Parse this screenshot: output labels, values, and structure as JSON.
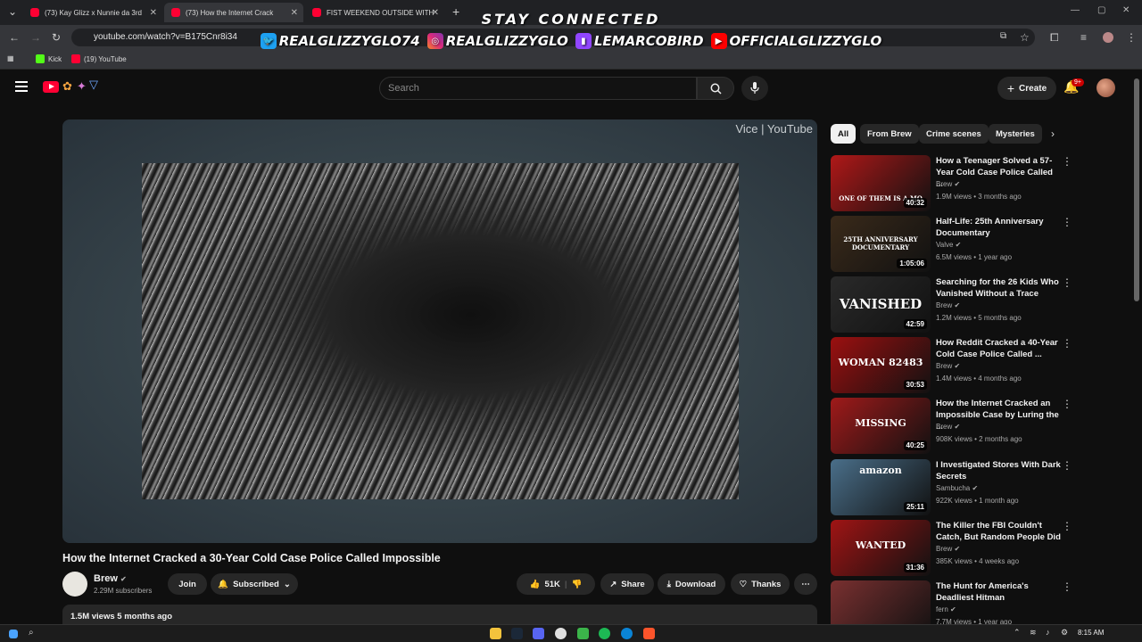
{
  "browser": {
    "tabs": [
      {
        "label": "(73) Kay Glizz x Nunnie da 3rd"
      },
      {
        "label": "(73) How the Internet Crack"
      },
      {
        "label": "FIST WEEKEND OUTSIDE WITH"
      }
    ],
    "url": "youtube.com/watch?v=B175Cnr8i34",
    "bookmarks": [
      {
        "label": "Kick"
      },
      {
        "label": "(19) YouTube"
      }
    ]
  },
  "overlay": {
    "headline": "STAY CONNECTED",
    "socials": [
      {
        "handle": "REALGLIZZYGLO74",
        "icon": "twitter-icon",
        "color": "#1da1f2"
      },
      {
        "handle": "REALGLIZZYGLO",
        "icon": "instagram-icon",
        "color": "#e1306c"
      },
      {
        "handle": "LEMARCOBIRD",
        "icon": "twitch-icon",
        "color": "#9146ff"
      },
      {
        "handle": "OFFICIALGLIZZYGLO",
        "icon": "youtube-icon",
        "color": "#ff0000"
      }
    ]
  },
  "youtube": {
    "search_placeholder": "Search",
    "create_label": "Create",
    "notifications_badge": "9+",
    "accent": "#ff0033"
  },
  "video": {
    "watermark": "Vice | YouTube",
    "title": "How the Internet Cracked a 30-Year Cold Case Police Called Impossible",
    "channel": "Brew",
    "subscribers": "2.29M subscribers",
    "join_label": "Join",
    "subscribed_label": "Subscribed",
    "likes": "51K",
    "share_label": "Share",
    "download_label": "Download",
    "thanks_label": "Thanks",
    "views_date": "1.5M views  5 months ago"
  },
  "chips": [
    {
      "label": "All"
    },
    {
      "label": "From Brew"
    },
    {
      "label": "Crime scenes"
    },
    {
      "label": "Mysteries"
    }
  ],
  "recommendations": [
    {
      "title": "How a Teenager Solved a 57-Year Cold Case Police Called ...",
      "channel": "Brew",
      "meta": "1.9M views • 3 months ago",
      "duration": "40:32",
      "thumb_text": "ONE OF THEM IS A MO",
      "thumb_color": "#b01818"
    },
    {
      "title": "Half-Life: 25th Anniversary Documentary",
      "channel": "Valve",
      "meta": "6.5M views • 1 year ago",
      "duration": "1:05:06",
      "thumb_text": "25TH ANNIVERSARY DOCUMENTARY",
      "thumb_color": "#3a2a1a"
    },
    {
      "title": "Searching for the 26 Kids Who Vanished Without a Trace",
      "channel": "Brew",
      "meta": "1.2M views • 5 months ago",
      "duration": "42:59",
      "thumb_text": "VANISHED",
      "thumb_color": "#2a2a2a"
    },
    {
      "title": "How Reddit Cracked a 40-Year Cold Case Police Called ...",
      "channel": "Brew",
      "meta": "1.4M views • 4 months ago",
      "duration": "30:53",
      "thumb_text": "WOMAN 82483",
      "thumb_color": "#9c1010"
    },
    {
      "title": "How the Internet Cracked an Impossible Case by Luring the ...",
      "channel": "Brew",
      "meta": "908K views • 2 months ago",
      "duration": "40:25",
      "thumb_text": "MISSING",
      "thumb_color": "#a01a1a"
    },
    {
      "title": "I Investigated Stores With Dark Secrets",
      "channel": "Sambucha",
      "meta": "922K views • 1 month ago",
      "duration": "25:11",
      "thumb_text": "amazon",
      "thumb_color": "#4a6f8a"
    },
    {
      "title": "The Killer the FBI Couldn't Catch, But Random People Did",
      "channel": "Brew",
      "meta": "385K views • 4 weeks ago",
      "duration": "31:36",
      "thumb_text": "WANTED",
      "thumb_color": "#a01414"
    },
    {
      "title": "The Hunt for America's Deadliest Hitman",
      "channel": "fern",
      "meta": "7.7M views • 1 year ago",
      "duration": "",
      "thumb_text": "",
      "thumb_color": "#7a3030"
    }
  ],
  "taskbar": {
    "time": "8:15 AM"
  }
}
